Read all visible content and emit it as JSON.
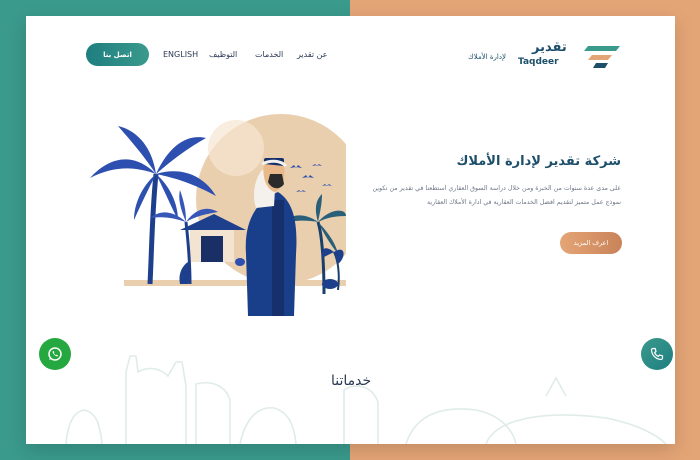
{
  "header": {
    "contact_label": "اتصل بنا",
    "nav": {
      "english": "ENGLISH",
      "jobs": "التوظيف",
      "services": "الخدمات",
      "about": "عن تقدير"
    },
    "logo": {
      "arabic": "تقدير",
      "english": "Taqdeer",
      "subtitle": "لإدارة الأملاك"
    }
  },
  "hero": {
    "title": "شركة تقدير لإدارة الأملاك",
    "text": "على مدى عدة سنوات من الخبرة ومن خلال دراسة السوق العقاري استطعنا في تقدير من تكوين نموذج عمل متميز لتقديم افضل الخدمات العقارية في ادارة الأملاك العقارية",
    "more_label": "اعرف المزيد"
  },
  "services": {
    "title": "خدماتنا"
  },
  "floating": {
    "whatsapp_icon": "whatsapp-icon",
    "phone_icon": "phone-icon"
  },
  "colors": {
    "teal": "#3a9a8c",
    "orange": "#e4a576",
    "navy": "#1d4f6b",
    "whatsapp": "#25a83f"
  }
}
